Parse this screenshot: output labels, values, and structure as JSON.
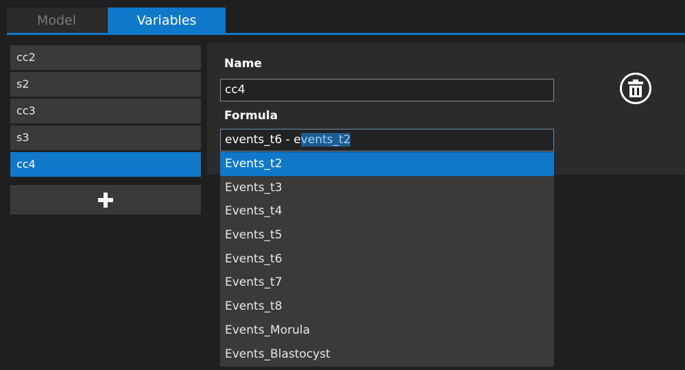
{
  "tabs": [
    {
      "label": "Model",
      "active": false
    },
    {
      "label": "Variables",
      "active": true
    }
  ],
  "variables": [
    {
      "label": "cc2",
      "selected": false
    },
    {
      "label": "s2",
      "selected": false
    },
    {
      "label": "cc3",
      "selected": false
    },
    {
      "label": "s3",
      "selected": false
    },
    {
      "label": "cc4",
      "selected": true
    }
  ],
  "add_button": {
    "icon": "plus-icon"
  },
  "editor": {
    "name_label": "Name",
    "name_value": "cc4",
    "formula_label": "Formula",
    "formula_typed": "events_t6 - e",
    "formula_completion": "vents_t2",
    "delete_icon": "trash-icon"
  },
  "autocomplete": [
    {
      "label": "Events_t2",
      "highlighted": true
    },
    {
      "label": "Events_t3",
      "highlighted": false
    },
    {
      "label": "Events_t4",
      "highlighted": false
    },
    {
      "label": "Events_t5",
      "highlighted": false
    },
    {
      "label": "Events_t6",
      "highlighted": false
    },
    {
      "label": "Events_t7",
      "highlighted": false
    },
    {
      "label": "Events_t8",
      "highlighted": false
    },
    {
      "label": "Events_Morula",
      "highlighted": false
    },
    {
      "label": "Events_Blastocyst",
      "highlighted": false
    }
  ],
  "colors": {
    "accent": "#0f78c9",
    "background": "#1f1f1f",
    "panel": "#2b2b2b",
    "item": "#3a3a3a"
  }
}
